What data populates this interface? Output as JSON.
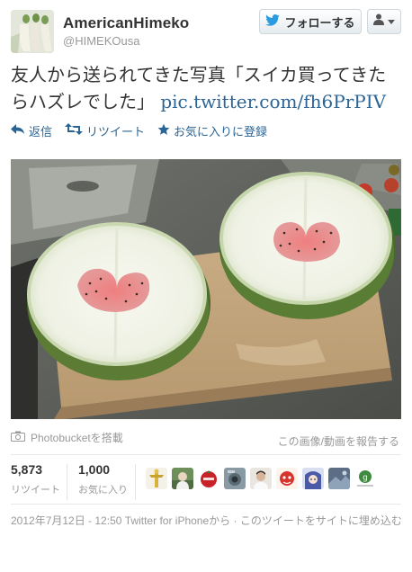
{
  "user": {
    "display_name": "AmericanHimeko",
    "screen_name": "@HIMEKOusa"
  },
  "follow_button": {
    "label": "フォローする"
  },
  "tweet": {
    "text": "友人から送られてきた写真「スイカ買ってきたらハズレでした」",
    "link": "pic.twitter.com/fh6PrPIV"
  },
  "actions": {
    "reply": "返信",
    "retweet": "リツイート",
    "favorite": "お気に入りに登録"
  },
  "photo": {
    "credit": "Photobucketを搭載",
    "report": "この画像/動画を報告する"
  },
  "stats": {
    "retweets": {
      "count": "5,873",
      "label": "リツイート"
    },
    "favorites": {
      "count": "1,000",
      "label": "お気に入り"
    }
  },
  "meta": {
    "timestamp": "2012年7月12日 - 12:50",
    "via": "Twitter for iPhoneから",
    "separator": " · ",
    "embed": "このツイートをサイトに埋め込む"
  },
  "colors": {
    "link": "#2a6496",
    "twitter_bird": "#2a9be0",
    "muted": "#999999"
  },
  "icons": {
    "reply": "reply-arrow-icon",
    "retweet": "retweet-icon",
    "favorite": "star-icon",
    "camera": "camera-icon",
    "bird": "twitter-bird-icon",
    "user": "user-silhouette-icon"
  }
}
